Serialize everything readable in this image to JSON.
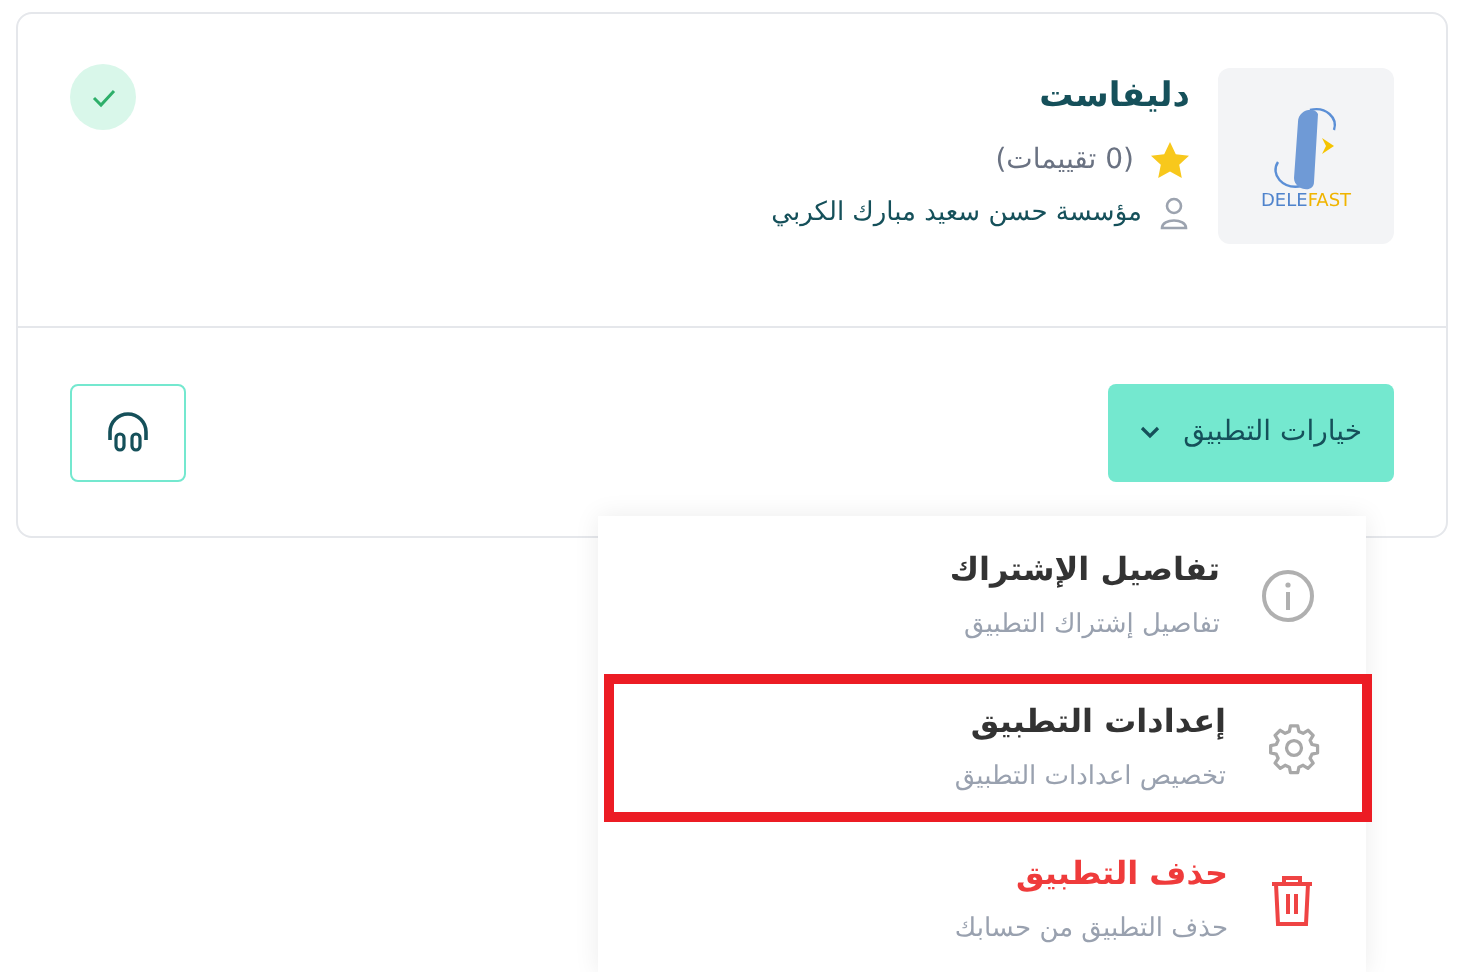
{
  "app": {
    "name": "دليفاست",
    "logo_text": "DELEFAST",
    "rating_count": "(0 تقييمات)",
    "owner": "مؤسسة حسن سعيد مبارك الكربي",
    "verified": true
  },
  "options_button": {
    "label": "خيارات التطبيق",
    "expanded": true
  },
  "menu": [
    {
      "kind": "info",
      "title": "تفاصيل الإشتراك",
      "subtitle": "تفاصيل إشتراك التطبيق",
      "highlighted": false
    },
    {
      "kind": "settings",
      "title": "إعدادات التطبيق",
      "subtitle": "تخصيص اعدادات التطبيق",
      "highlighted": true
    },
    {
      "kind": "delete",
      "title": "حذف التطبيق",
      "subtitle": "حذف التطبيق من حسابك",
      "highlighted": false
    }
  ]
}
